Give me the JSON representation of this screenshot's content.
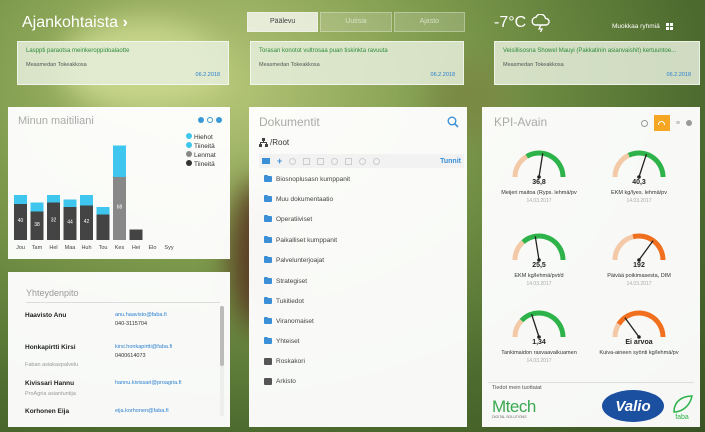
{
  "header": {
    "news_title": "Ajankohtaista",
    "news_arrow": "›",
    "temperature": "-7°C",
    "groups_label": "Muokkaa ryhmiä"
  },
  "tabs": [
    {
      "label": "Päälevu"
    },
    {
      "label": "Uutisia"
    },
    {
      "label": "Ajasto"
    }
  ],
  "news": [
    {
      "title": "Lasppti paraotsa meinkeroppidoalaotte",
      "author": "Measmedan Tokeakkosa",
      "date": "06.2.2018"
    },
    {
      "title": "Torasan konotot vultrosaa puan tiskinkta ravuuta",
      "author": "Measmedan Tokeakkosa",
      "date": "06.2.2018"
    },
    {
      "title": "Veisillisosna Showel Mauyi (Pakkatinin asianvaishit) kertuuntoe...",
      "author": "Measmedan Tokeakkosa",
      "date": "06.2.2018"
    }
  ],
  "milk_panel": {
    "title": "Minun maitiliani",
    "legend": [
      "Hiehot",
      "Tiineitä",
      "Lenmat",
      "Tiineitä"
    ],
    "legend_colors": [
      "#3ec6ee",
      "#3ec6ee",
      "#888888",
      "#333333"
    ]
  },
  "chart_data": {
    "type": "bar",
    "categories": [
      "Jou",
      "Tam",
      "Hel",
      "Maa",
      "Huh",
      "Tou",
      "Kes",
      "Hei",
      "Elo",
      "Syy"
    ],
    "series": [
      {
        "name": "Hiehot",
        "values": [
          12,
          12,
          10,
          10,
          14,
          10,
          42,
          0,
          0,
          0
        ]
      },
      {
        "name": "Lenmat",
        "values": [
          48,
          38,
          50,
          44,
          46,
          34,
          84,
          14,
          0,
          0
        ]
      }
    ],
    "data_labels": [
      "40",
      "38",
      "32",
      "44",
      "42",
      "",
      "68",
      "",
      "",
      ""
    ],
    "top_labels": [
      "",
      "",
      "",
      "",
      "",
      "",
      "",
      "",
      "",
      ""
    ],
    "ylim": [
      0,
      140
    ]
  },
  "contacts": {
    "title": "Yhteydenpito",
    "rows": [
      {
        "name": "Haavisto Anu",
        "sub": "",
        "email": "anu.haavisto@faba.fi",
        "phone": "040-3115704"
      },
      {
        "name": "Honkapirtti Kirsi",
        "sub": "Faban asiakaspalvelu",
        "email": "kirsi.honkapirtti@faba.fi",
        "phone": "0400614073"
      },
      {
        "name": "Kivissari Hannu",
        "sub": "ProAgria asiantuntija",
        "email": "hannu.kivissari@proagria.fi",
        "phone": ""
      },
      {
        "name": "Korhonen Eija",
        "sub": "",
        "email": "eija.korhonen@faba.fi",
        "phone": ""
      }
    ]
  },
  "documents": {
    "title": "Dokumentit",
    "root": "/Root",
    "tunnit": "Tunnit",
    "items": [
      {
        "label": "Biosnoplusasn kumppanit",
        "icon": "folder"
      },
      {
        "label": "Muu dokumentaatio",
        "icon": "folder"
      },
      {
        "label": "Operatiiviset",
        "icon": "folder"
      },
      {
        "label": "Paikalliset kumppanit",
        "icon": "folder"
      },
      {
        "label": "Palvelunterjoajat",
        "icon": "folder"
      },
      {
        "label": "Strategiset",
        "icon": "folder"
      },
      {
        "label": "Tukitiedot",
        "icon": "folder"
      },
      {
        "label": "Viranomaiset",
        "icon": "folder"
      },
      {
        "label": "Yhteiset",
        "icon": "folder"
      },
      {
        "label": "Roskakori",
        "icon": "trash"
      },
      {
        "label": "Arkisto",
        "icon": "archive"
      }
    ]
  },
  "kpi": {
    "title": "KPI-Avain",
    "gauges": [
      {
        "value": "36,8",
        "label": "Meijeri maitoa (Ryps. lehmä/pv",
        "date": "14.03.2017",
        "level": 0.55,
        "color": "#2db34a"
      },
      {
        "value": "40,3",
        "label": "EKM kg/lyes. lehmä/pv",
        "date": "14.03.2017",
        "level": 0.6,
        "color": "#2db34a"
      },
      {
        "value": "25,5",
        "label": "EKM kg/lehmä/pvt/d",
        "date": "14.03.2017",
        "level": 0.45,
        "color": "#2db34a"
      },
      {
        "value": "192",
        "label": "Päivää poikimasesta, DIM",
        "date": "14.03.2017",
        "level": 0.7,
        "color": "#f07020"
      },
      {
        "value": "1,34",
        "label": "Tankimaidon rasvaavaikuamen",
        "date": "14.03.2017",
        "level": 0.4,
        "color": "#2db34a"
      },
      {
        "value": "Ei arvoa",
        "label": "Kuiva-aineen syönti kg/lehmä/pv",
        "date": "",
        "level": 0.3,
        "color": "#f07020"
      }
    ],
    "providers_label": "Tiedot mein tuottaiat",
    "mtech_logo": "Mtech",
    "mtech_sub": "DIGITAL SOLUTIONS",
    "valio_logo": "Valio",
    "faba_logo": "faba"
  }
}
